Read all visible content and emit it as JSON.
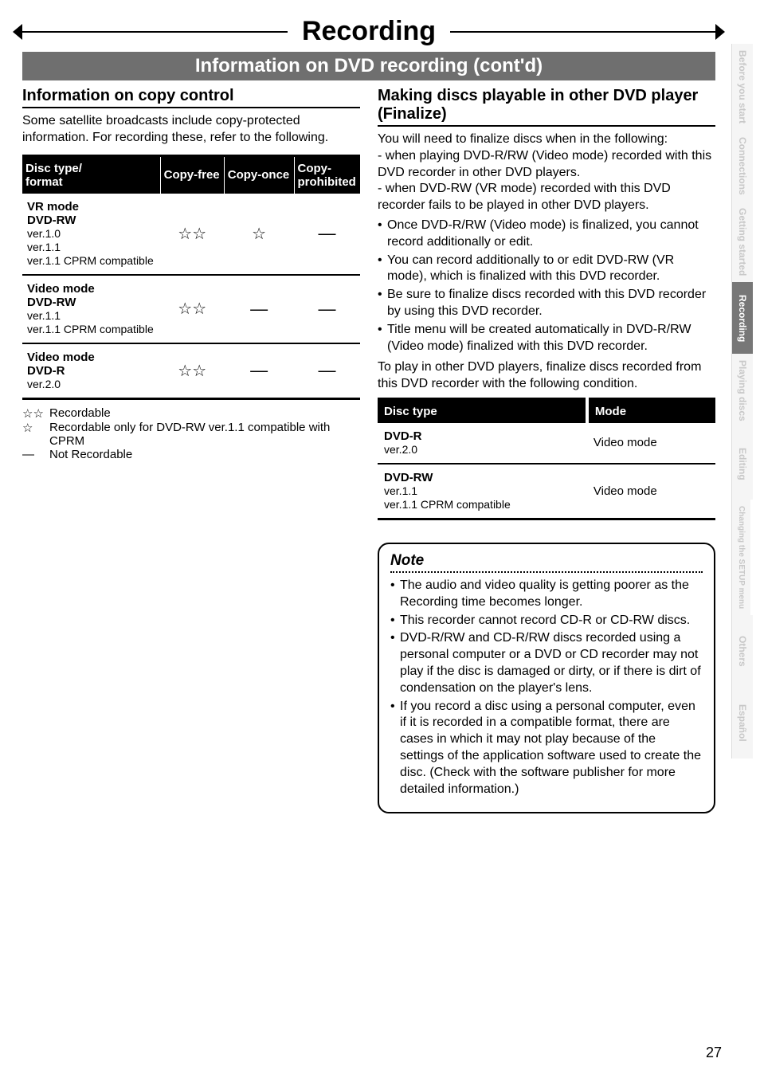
{
  "chapter_title": "Recording",
  "section_banner": "Information on DVD recording (cont'd)",
  "page_number": "27",
  "side_tabs": [
    {
      "label": "Before you start",
      "active": false
    },
    {
      "label": "Connections",
      "active": false
    },
    {
      "label": "Getting started",
      "active": false
    },
    {
      "label": "Recording",
      "active": true
    },
    {
      "label": "Playing discs",
      "active": false
    },
    {
      "label": "Editing",
      "active": false
    },
    {
      "label": "Changing the SETUP menu",
      "active": false
    },
    {
      "label": "Others",
      "active": false
    },
    {
      "label": "Español",
      "active": false
    }
  ],
  "left": {
    "heading": "Information on copy control",
    "intro": "Some satellite broadcasts include copy-protected information. For recording these, refer to the following.",
    "table": {
      "headers": [
        "Disc type/\nformat",
        "Copy-free",
        "Copy-once",
        "Copy-\nprohibited"
      ],
      "rows": [
        {
          "type_bold": "VR mode\nDVD-RW",
          "type_sub": "ver.1.0\nver.1.1\nver.1.1 CPRM compatible",
          "free": "☆☆",
          "once": "☆",
          "proh": "—"
        },
        {
          "type_bold": "Video mode\nDVD-RW",
          "type_sub": "ver.1.1\nver.1.1 CPRM compatible",
          "free": "☆☆",
          "once": "—",
          "proh": "—"
        },
        {
          "type_bold": "Video mode\nDVD-R",
          "type_sub": "ver.2.0",
          "free": "☆☆",
          "once": "—",
          "proh": "—"
        }
      ]
    },
    "legend": [
      {
        "sym": "☆☆",
        "text": "Recordable"
      },
      {
        "sym": "☆",
        "text": "Recordable only for DVD-RW ver.1.1 compatible with CPRM"
      },
      {
        "sym": "—",
        "text": "Not Recordable"
      }
    ]
  },
  "right": {
    "heading": "Making discs playable in other DVD player (Finalize)",
    "para1": "You will need to finalize discs when in the following:\n- when playing DVD-R/RW (Video mode) recorded with this DVD recorder in other DVD players.\n- when DVD-RW (VR mode) recorded with this DVD recorder fails to be played in other DVD players.",
    "bullets1": [
      "Once DVD-R/RW (Video mode) is finalized, you cannot record additionally or edit.",
      "You can record additionally to or edit DVD-RW (VR mode), which is finalized with this DVD recorder.",
      "Be sure to finalize discs recorded with this DVD recorder by using this DVD recorder.",
      "Title menu will be created automatically in DVD-R/RW (Video mode) finalized with this DVD recorder."
    ],
    "para2": "To play in other DVD players, finalize discs recorded from this DVD recorder with the following condition.",
    "mode_table": {
      "headers": [
        "Disc type",
        "Mode"
      ],
      "rows": [
        {
          "disc_bold": "DVD-R",
          "disc_sub": "ver.2.0",
          "mode": "Video mode"
        },
        {
          "disc_bold": "DVD-RW",
          "disc_sub": "ver.1.1\nver.1.1 CPRM compatible",
          "mode": "Video mode"
        }
      ]
    },
    "note": {
      "title": "Note",
      "bullets": [
        "The audio and video quality is getting poorer as the Recording time becomes longer.",
        "This recorder cannot record CD-R or CD-RW discs.",
        "DVD-R/RW and CD-R/RW discs recorded using a personal computer or a DVD or CD recorder may not play if the disc is damaged or dirty, or if there is dirt of condensation on the player's lens.",
        "If you record a disc using a personal computer, even if it is recorded in a compatible format, there are cases in which it may not play because of the settings of the application software used to create the disc. (Check with the software publisher for more detailed information.)"
      ]
    }
  }
}
